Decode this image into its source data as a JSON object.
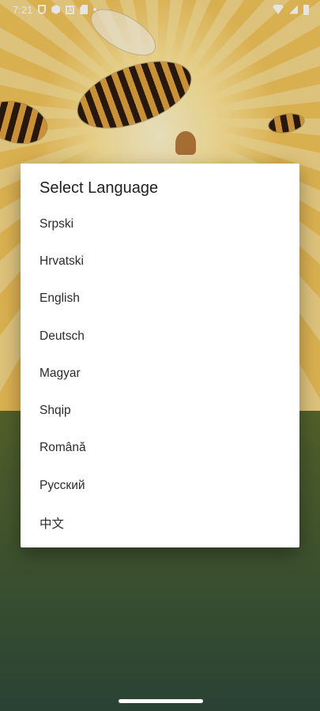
{
  "status_bar": {
    "time": "7:21"
  },
  "dialog": {
    "title": "Select Language",
    "languages": [
      "Srpski",
      "Hrvatski",
      "English",
      "Deutsch",
      "Magyar",
      "Shqip",
      "Română",
      "Русский",
      "中文"
    ]
  },
  "icons": {
    "status": [
      "shield-icon",
      "app-icon",
      "a-box-icon",
      "sd-card-icon",
      "notification-dot-icon",
      "wifi-icon",
      "signal-icon",
      "battery-icon"
    ]
  }
}
